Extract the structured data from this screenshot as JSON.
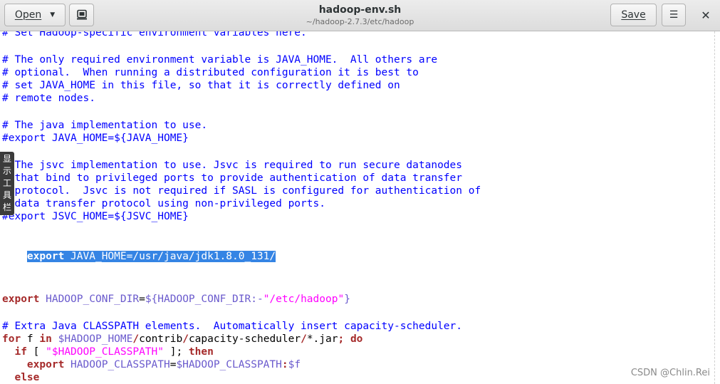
{
  "header": {
    "open_label": "Open",
    "open_arrow": "▼",
    "new_tab_icon": "⎙",
    "title": "hadoop-env.sh",
    "subtitle": "~/hadoop-2.7.3/etc/hadoop",
    "save_label": "Save",
    "menu_icon": "☰",
    "close_icon": "✕"
  },
  "editor": {
    "lines": {
      "l0": "# Set Hadoop-specific environment variables here.",
      "l2": "# The only required environment variable is JAVA_HOME.  All others are",
      "l3": "# optional.  When running a distributed configuration it is best to",
      "l4": "# set JAVA_HOME in this file, so that it is correctly defined on",
      "l5": "# remote nodes.",
      "l7": "# The java implementation to use.",
      "l8": "#export JAVA_HOME=${JAVA_HOME}",
      "l10": "# The jsvc implementation to use. Jsvc is required to run secure datanodes",
      "l11": "# that bind to privileged ports to provide authentication of data transfer",
      "l12": "# protocol.  Jsvc is not required if SASL is configured for authentication of",
      "l13": "# data transfer protocol using non-privileged ports.",
      "l14": "#export JSVC_HOME=${JSVC_HOME}",
      "l16_kw": "export",
      "l16_rest": " JAVA_HOME=/usr/java/jdk1.8.0_131/",
      "l20_kw": "export",
      "l20_var": " HADOOP_CONF_DIR",
      "l20_eq": "=",
      "l20_open": "${HADOOP_CONF_DIR:-",
      "l20_str": "\"/etc/hadoop\"",
      "l20_close": "}",
      "l22": "# Extra Java CLASSPATH elements.  Automatically insert capacity-scheduler.",
      "l23_for": "for",
      "l23_f": " f ",
      "l23_in": "in",
      "l23_v1": " $HADOOP_HOME",
      "l23_s1": "/",
      "l23_p1": "contrib",
      "l23_s2": "/",
      "l23_p2": "capacity-scheduler",
      "l23_s3": "/",
      "l23_p3": "*.jar",
      "l23_semi": ";",
      "l23_do": " do",
      "l24_if": "  if",
      "l24_b1": " [ ",
      "l24_str": "\"$HADOOP_CLASSPATH\"",
      "l24_b2": " ]; ",
      "l24_then": "then",
      "l25_export": "    export",
      "l25_var": " HADOOP_CLASSPATH",
      "l25_eq": "=",
      "l25_v1": "$HADOOP_CLASSPATH",
      "l25_colon": ":",
      "l25_v2": "$f",
      "l26_else": "  else"
    }
  },
  "side_toolbar": {
    "chars": [
      "显",
      "示",
      "工",
      "具",
      "栏"
    ]
  },
  "watermark": "CSDN @Chlin.Rei",
  "colors": {
    "comment": "#0000ff",
    "keyword": "#a52a2a",
    "variable": "#6a5acd",
    "string": "#ff00ff",
    "selection": "#3584e4"
  }
}
